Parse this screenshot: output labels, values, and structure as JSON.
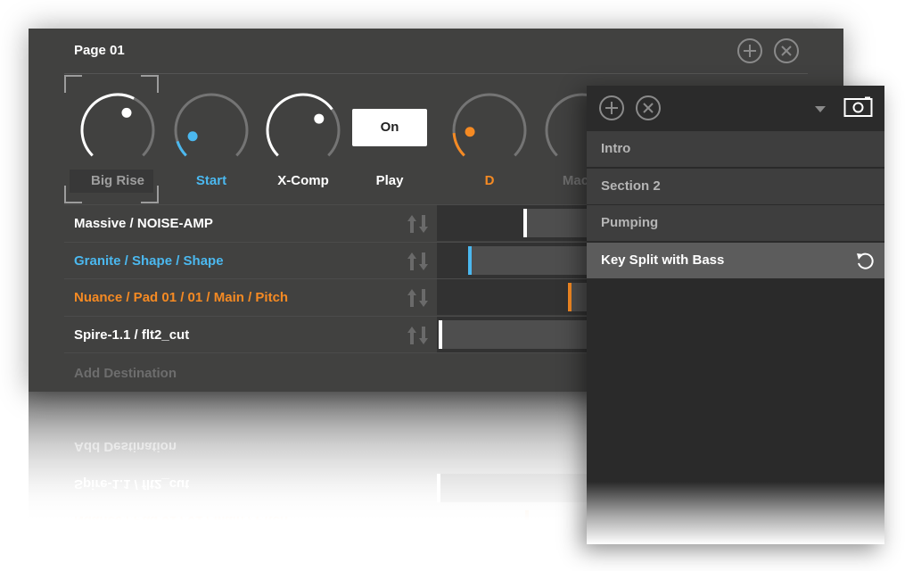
{
  "colors": {
    "accent_blue": "#4bb8ef",
    "accent_orange": "#f58a23",
    "white": "#ffffff",
    "muted": "#6d6d6d",
    "label_grey": "#9e9e9e"
  },
  "main": {
    "page_title": "Page 01",
    "header_buttons": [
      {
        "icon": "plus-circle-icon"
      },
      {
        "icon": "close-circle-icon"
      }
    ],
    "knobs": [
      {
        "label": "Big Rise",
        "value": 0.6,
        "color": "#ffffff",
        "label_color": "#9e9e9e",
        "selected": true
      },
      {
        "label": "Start",
        "value": 0.1,
        "color": "#4bb8ef",
        "label_color": "#4bb8ef",
        "selected": false
      },
      {
        "label": "X-Comp",
        "value": 0.7,
        "color": "#ffffff",
        "label_color": "#ffffff",
        "selected": false
      },
      {
        "label": "D",
        "value": 0.15,
        "color": "#f58a23",
        "label_color": "#f58a23",
        "selected": false
      },
      {
        "label": "Macro",
        "value": 0.0,
        "color": "#6d6d6d",
        "label_color": "#6d6d6d",
        "selected": false
      }
    ],
    "toggle": {
      "button_label": "On",
      "label": "Play"
    },
    "destinations": [
      {
        "name": "Massive / NOISE-AMP",
        "color": "#ffffff",
        "value": 0.38,
        "marker_color": "#ffffff"
      },
      {
        "name": "Granite / Shape / Shape",
        "color": "#4bb8ef",
        "value": 0.13,
        "marker_color": "#4bb8ef"
      },
      {
        "name": "Nuance / Pad 01 / 01 / Main / Pitch",
        "color": "#f58a23",
        "value": 0.58,
        "marker_color": "#f58a23"
      },
      {
        "name": "Spire-1.1 / flt2_cut",
        "color": "#ffffff",
        "value": 0.0,
        "marker_color": "#ffffff"
      }
    ],
    "add_destination_label": "Add Destination"
  },
  "snapshots": {
    "header_buttons": [
      {
        "icon": "plus-circle-icon"
      },
      {
        "icon": "close-circle-icon"
      }
    ],
    "dropdown_icon": "triangle-down-icon",
    "camera_icon": "camera-icon",
    "items": [
      {
        "label": "Intro",
        "selected": false
      },
      {
        "label": "Section 2",
        "selected": false
      },
      {
        "label": "Pumping",
        "selected": false
      },
      {
        "label": "Key Split with Bass",
        "selected": true,
        "icon": "revert-icon"
      }
    ]
  }
}
